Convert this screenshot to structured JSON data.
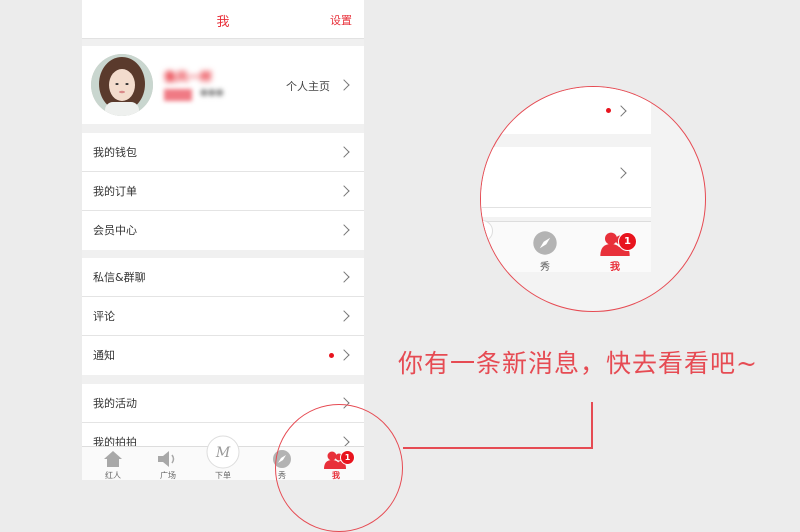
{
  "header": {
    "title": "我",
    "settings_label": "设置"
  },
  "profile": {
    "username": "像风一样",
    "homepage_label": "个人主页"
  },
  "menu_groups": [
    {
      "items": [
        {
          "label": "我的钱包"
        },
        {
          "label": "我的订单"
        },
        {
          "label": "会员中心"
        }
      ]
    },
    {
      "items": [
        {
          "label": "私信&群聊"
        },
        {
          "label": "评论"
        },
        {
          "label": "通知",
          "has_dot": true
        }
      ]
    },
    {
      "items": [
        {
          "label": "我的活动"
        },
        {
          "label": "我的拍拍"
        }
      ]
    }
  ],
  "tabs": [
    {
      "label": "红人",
      "icon": "home-icon"
    },
    {
      "label": "广场",
      "icon": "speaker-icon"
    },
    {
      "label": "下单",
      "icon": "m-logo-icon"
    },
    {
      "label": "秀",
      "icon": "compass-icon"
    },
    {
      "label": "我",
      "icon": "user-icon",
      "active": true,
      "badge": "1"
    }
  ],
  "zoom": {
    "tab_show_label": "秀",
    "tab_me_label": "我",
    "badge": "1"
  },
  "callout": {
    "message": "你有一条新消息，快去看看吧~"
  },
  "colors": {
    "accent": "#e8303a",
    "annotation": "#e64b53",
    "dot": "#e8141e"
  }
}
